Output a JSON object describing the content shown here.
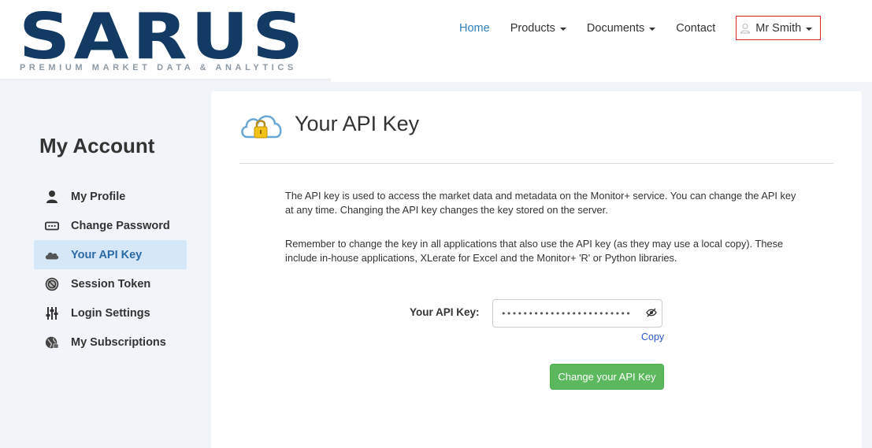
{
  "brand": {
    "logo_text": "SARUS",
    "tagline": "PREMIUM MARKET DATA & ANALYTICS",
    "color": "#123a63"
  },
  "nav": {
    "items": [
      {
        "label": "Home",
        "active": true
      },
      {
        "label": "Products",
        "dropdown": true
      },
      {
        "label": "Documents",
        "dropdown": true
      },
      {
        "label": "Contact"
      }
    ],
    "user": {
      "label": "Mr Smith",
      "icon": "user-icon"
    }
  },
  "sidebar": {
    "title": "My Account",
    "items": [
      {
        "label": "My Profile",
        "icon": "person-icon"
      },
      {
        "label": "Change Password",
        "icon": "password-icon"
      },
      {
        "label": "Your API Key",
        "icon": "cloud-icon",
        "active": true
      },
      {
        "label": "Session Token",
        "icon": "token-icon"
      },
      {
        "label": "Login Settings",
        "icon": "sliders-icon"
      },
      {
        "label": "My Subscriptions",
        "icon": "globe-icon"
      }
    ]
  },
  "main": {
    "title": "Your API Key",
    "icon": "cloud-lock-icon",
    "paragraph1": "The API key is used to access the market data and metadata on the Monitor+ service. You can change the API key at any time. Changing the API key changes the key stored on the server.",
    "paragraph2": "Remember to change the key in all applications that also use the API key (as they may use a local copy). These include in-house applications, XLerate for Excel and the Monitor+ 'R' or Python libraries.",
    "key_label": "Your API Key:",
    "key_value": "••••••••••••••••••••••••",
    "copy_label": "Copy",
    "change_button": "Change your API Key"
  },
  "colors": {
    "accent": "#2c7fb8",
    "active_bg": "#d6e7f7",
    "button": "#5cb85c",
    "highlight_border": "#d9242a"
  }
}
